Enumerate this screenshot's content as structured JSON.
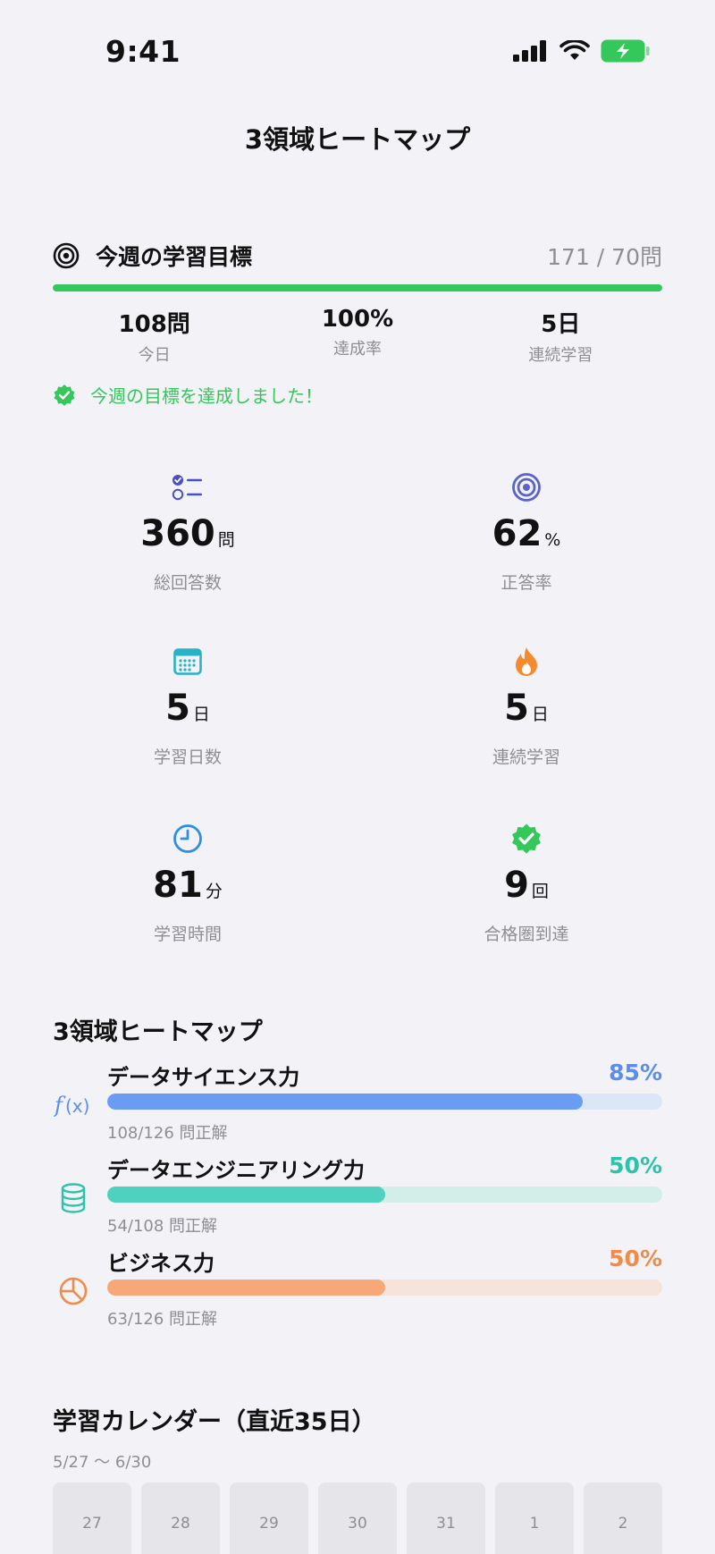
{
  "status_bar": {
    "time": "9:41"
  },
  "nav": {
    "title": "3領域ヒートマップ"
  },
  "weekly_goal": {
    "title": "今週の学習目標",
    "count": "171 / 70問",
    "progress_fraction": 1.0,
    "stats": [
      {
        "value": "108問",
        "label": "今日"
      },
      {
        "value": "100%",
        "label": "達成率"
      },
      {
        "value": "5日",
        "label": "連続学習"
      }
    ],
    "achieved_text": "今週の目標を達成しました！"
  },
  "stats": [
    {
      "icon": "checklist-icon",
      "value": "360",
      "unit": "問",
      "label": "総回答数"
    },
    {
      "icon": "target-icon",
      "value": "62",
      "unit": "%",
      "label": "正答率"
    },
    {
      "icon": "calendar-icon",
      "value": "5",
      "unit": "日",
      "label": "学習日数"
    },
    {
      "icon": "flame-icon",
      "value": "5",
      "unit": "日",
      "label": "連続学習"
    },
    {
      "icon": "clock-icon",
      "value": "81",
      "unit": "分",
      "label": "学習時間"
    },
    {
      "icon": "verified-badge-icon",
      "value": "9",
      "unit": "回",
      "label": "合格圏到達"
    }
  ],
  "heatmap": {
    "title": "3領域ヒートマップ",
    "domains": [
      {
        "icon": "function-icon",
        "name": "データサイエンス力",
        "percent_text": "85%",
        "fraction": 0.857,
        "detail": "108/126 問正解",
        "color": "#6a9cf4",
        "track": "#dbe6f7"
      },
      {
        "icon": "database-icon",
        "name": "データエンジニアリング力",
        "percent_text": "50%",
        "fraction": 0.5,
        "detail": "54/108 問正解",
        "color": "#4fd1bf",
        "track": "#d3ede9"
      },
      {
        "icon": "pie-chart-icon",
        "name": "ビジネス力",
        "percent_text": "50%",
        "fraction": 0.5,
        "detail": "63/126 問正解",
        "color": "#f8a878",
        "track": "#f6e3d9"
      }
    ]
  },
  "calendar": {
    "title": "学習カレンダー（直近35日）",
    "range": "5/27 〜 6/30",
    "days": [
      "27",
      "28",
      "29",
      "30",
      "31",
      "1",
      "2"
    ]
  },
  "colors": {
    "green": "#34c759",
    "accent_blue": "#5b8def",
    "accent_teal": "#2cc4a8",
    "accent_orange": "#f08c4a"
  }
}
